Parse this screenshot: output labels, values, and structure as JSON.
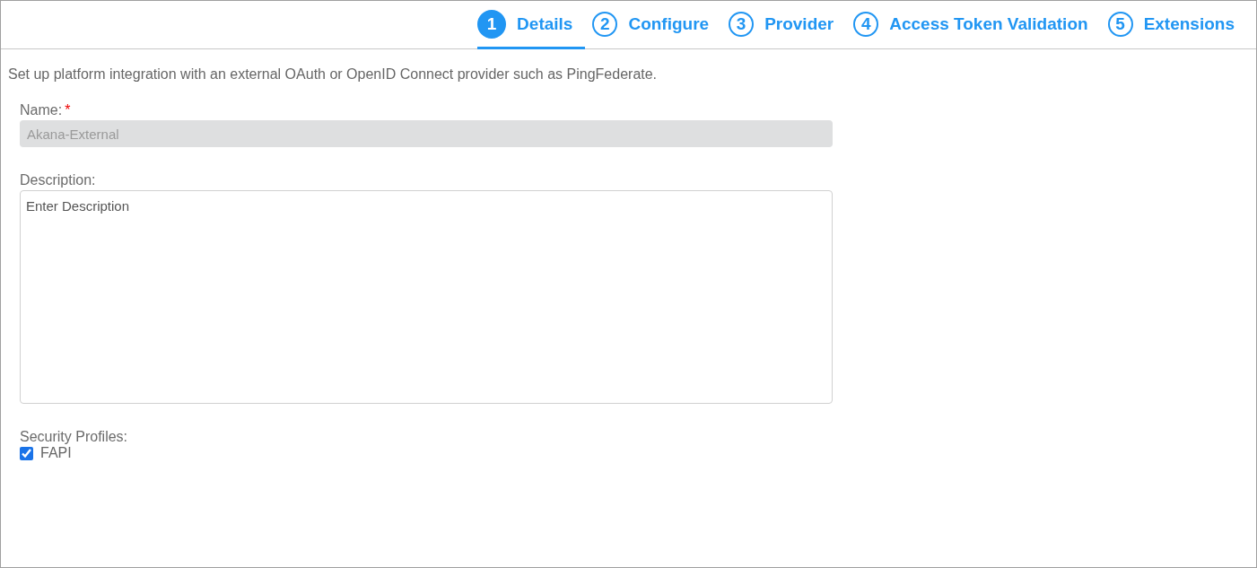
{
  "steps": [
    {
      "number": "1",
      "label": "Details",
      "selected": true
    },
    {
      "number": "2",
      "label": "Configure",
      "selected": false
    },
    {
      "number": "3",
      "label": "Provider",
      "selected": false
    },
    {
      "number": "4",
      "label": "Access Token Validation",
      "selected": false
    },
    {
      "number": "5",
      "label": "Extensions",
      "selected": false
    }
  ],
  "intro": "Set up platform integration with an external OAuth or OpenID Connect provider such as PingFederate.",
  "name_field": {
    "label": "Name:",
    "required": true,
    "required_mark": "*",
    "value": "Akana-External",
    "disabled": true
  },
  "description_field": {
    "label": "Description:",
    "placeholder": "Enter Description"
  },
  "security_profiles": {
    "label": "Security Profiles:",
    "options": [
      {
        "label": "FAPI",
        "checked": true
      }
    ]
  }
}
